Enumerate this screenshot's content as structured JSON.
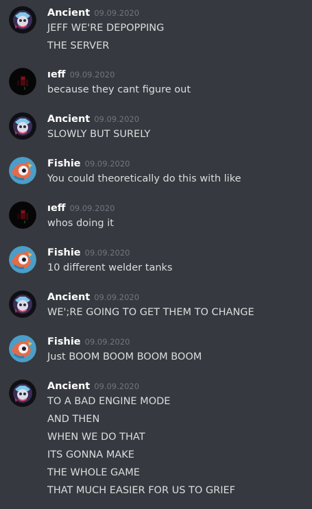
{
  "messages": [
    {
      "author": "Ancient",
      "avatar": "ancient-avatar",
      "timestamp": "09.09.2020",
      "lines": [
        "JEFF WE'RE DEPOPPING",
        "THE SERVER"
      ]
    },
    {
      "author": "ıeff",
      "avatar": "jeff-avatar",
      "timestamp": "09.09.2020",
      "lines": [
        "because they cant figure out"
      ]
    },
    {
      "author": "Ancient",
      "avatar": "ancient-avatar",
      "timestamp": "09.09.2020",
      "lines": [
        "SLOWLY BUT SURELY"
      ]
    },
    {
      "author": "Fishie",
      "avatar": "fishie-avatar",
      "timestamp": "09.09.2020",
      "lines": [
        "You could theoretically do this with like"
      ]
    },
    {
      "author": "ıeff",
      "avatar": "jeff-avatar",
      "timestamp": "09.09.2020",
      "lines": [
        "whos doing it"
      ]
    },
    {
      "author": "Fishie",
      "avatar": "fishie-avatar",
      "timestamp": "09.09.2020",
      "lines": [
        "10 different welder tanks"
      ]
    },
    {
      "author": "Ancient",
      "avatar": "ancient-avatar",
      "timestamp": "09.09.2020",
      "lines": [
        "WE';RE GOING TO GET THEM TO CHANGE"
      ]
    },
    {
      "author": "Fishie",
      "avatar": "fishie-avatar",
      "timestamp": "09.09.2020",
      "lines": [
        "Just BOOM BOOM BOOM BOOM"
      ]
    },
    {
      "author": "Ancient",
      "avatar": "ancient-avatar",
      "timestamp": "09.09.2020",
      "lines": [
        "TO A BAD ENGINE MODE",
        "AND THEN",
        "WHEN WE DO THAT",
        "ITS GONNA MAKE",
        "THE WHOLE GAME",
        "THAT MUCH EASIER FOR US TO GRIEF"
      ]
    }
  ],
  "colors": {
    "background": "#36393f",
    "author": "#ffffff",
    "timestamp": "#72767d",
    "text": "#dcddde"
  }
}
